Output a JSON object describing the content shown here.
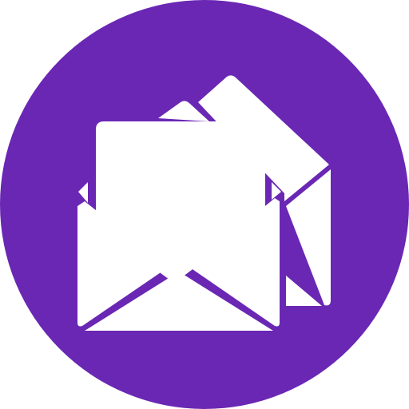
{
  "icon": {
    "name": "open-envelopes-icon",
    "description_label": "",
    "background_color": "#6a27b4",
    "foreground_color": "#ffffff"
  }
}
